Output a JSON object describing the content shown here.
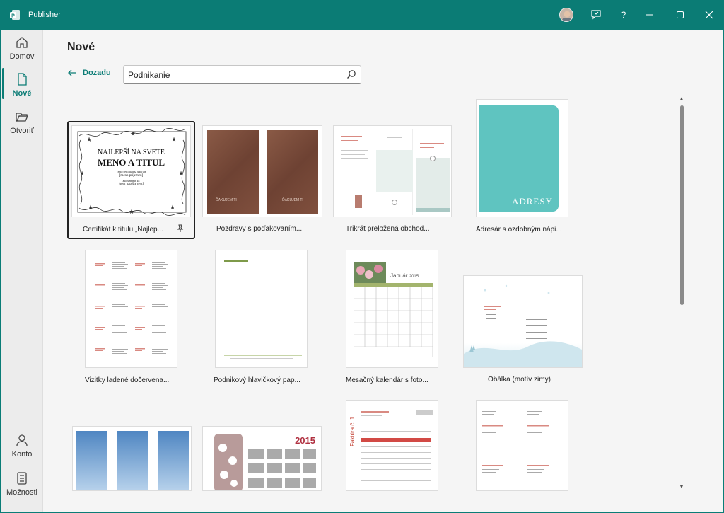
{
  "app": {
    "title": "Publisher"
  },
  "titlebar": {
    "help": "?"
  },
  "sidebar": {
    "items": [
      {
        "label": "Domov"
      },
      {
        "label": "Nové"
      },
      {
        "label": "Otvoriť"
      },
      {
        "label": "Konto"
      },
      {
        "label": "Možnosti"
      }
    ]
  },
  "main": {
    "heading": "Nové",
    "back_label": "Dozadu",
    "search_value": "Podnikanie"
  },
  "templates": [
    {
      "label": "Certifikát k titulu „Najlep..."
    },
    {
      "label": "Pozdravy s poďakovaním..."
    },
    {
      "label": "Trikrát preložená obchod..."
    },
    {
      "label": "Adresár s ozdobným nápi..."
    },
    {
      "label": "Vizitky ladené dočervena..."
    },
    {
      "label": "Podnikový hlavičkový pap..."
    },
    {
      "label": "Mesačný kalendár s foto..."
    },
    {
      "label": "Obálka (motív zimy)"
    },
    {
      "label": ""
    },
    {
      "label": ""
    },
    {
      "label": ""
    },
    {
      "label": ""
    }
  ],
  "thumb_text": {
    "cert_line1": "NAJLEPŠÍ NA SVETE",
    "cert_line2": "MENO A TITUL",
    "cert_small1": "Tento certifikát sa udeľuje",
    "cert_small2": "[meno príjemcu]",
    "cert_small3": "ako uznanie za",
    "cert_small4": "[sem napíšte text]",
    "thanks": "ĎAKUJEM TI",
    "adresy": "ADRESY",
    "calendar_month": "Január",
    "calendar_year": "2015",
    "year2015": "2015",
    "invoice": "Faktúra č. 1"
  },
  "colors": {
    "accent": "#0b7c75",
    "teal_card": "#5fc4c0",
    "brown_card": "#7b4c3b"
  }
}
